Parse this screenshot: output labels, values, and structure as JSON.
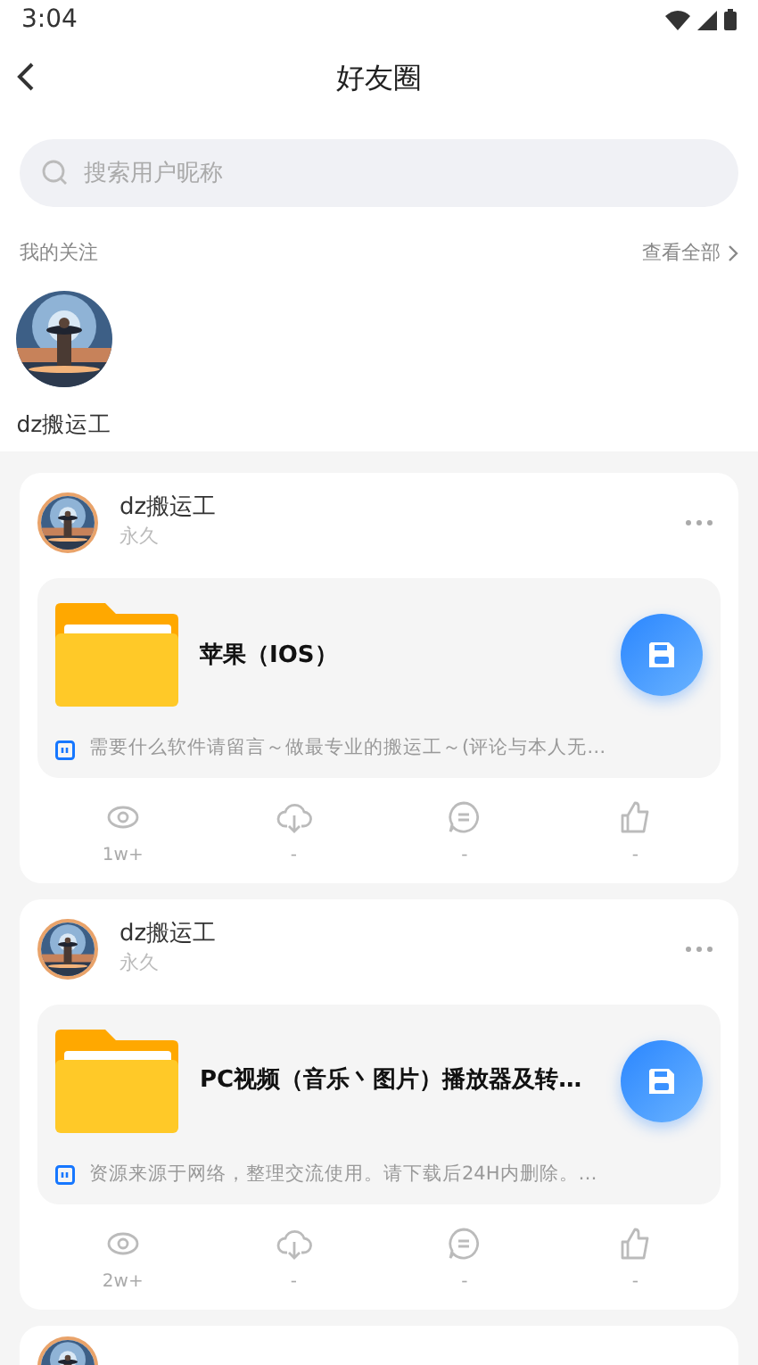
{
  "status_bar": {
    "time": "3:04"
  },
  "header": {
    "title": "好友圈"
  },
  "search": {
    "placeholder": "搜索用户昵称"
  },
  "following": {
    "title": "我的关注",
    "view_all": "查看全部",
    "users": [
      {
        "name": "dz搬运工"
      }
    ]
  },
  "posts": [
    {
      "kind": "post",
      "user": "dz搬运工",
      "duration": "永久",
      "file_title": "苹果（IOS）",
      "description": "需要什么软件请留言～做最专业的搬运工～(评论与本人无…",
      "stats": [
        "1w+",
        "-",
        "-",
        "-"
      ]
    },
    {
      "kind": "post",
      "user": "dz搬运工",
      "duration": "永久",
      "file_title": "PC视频（音乐丶图片）播放器及转…",
      "description": "资源来源于网络，整理交流使用。请下载后24H内删除。…",
      "stats": [
        "2w+",
        "-",
        "-",
        "-"
      ]
    },
    {
      "kind": "cut-off"
    }
  ]
}
